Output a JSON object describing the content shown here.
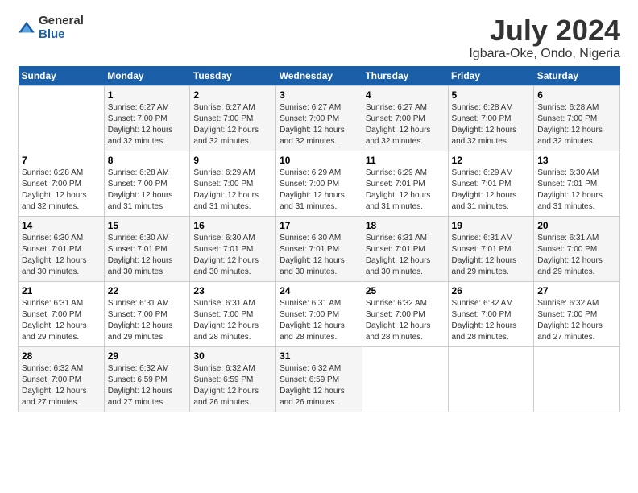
{
  "logo": {
    "general": "General",
    "blue": "Blue"
  },
  "title": "July 2024",
  "subtitle": "Igbara-Oke, Ondo, Nigeria",
  "days_of_week": [
    "Sunday",
    "Monday",
    "Tuesday",
    "Wednesday",
    "Thursday",
    "Friday",
    "Saturday"
  ],
  "weeks": [
    [
      {
        "num": "",
        "info": ""
      },
      {
        "num": "1",
        "info": "Sunrise: 6:27 AM\nSunset: 7:00 PM\nDaylight: 12 hours\nand 32 minutes."
      },
      {
        "num": "2",
        "info": "Sunrise: 6:27 AM\nSunset: 7:00 PM\nDaylight: 12 hours\nand 32 minutes."
      },
      {
        "num": "3",
        "info": "Sunrise: 6:27 AM\nSunset: 7:00 PM\nDaylight: 12 hours\nand 32 minutes."
      },
      {
        "num": "4",
        "info": "Sunrise: 6:27 AM\nSunset: 7:00 PM\nDaylight: 12 hours\nand 32 minutes."
      },
      {
        "num": "5",
        "info": "Sunrise: 6:28 AM\nSunset: 7:00 PM\nDaylight: 12 hours\nand 32 minutes."
      },
      {
        "num": "6",
        "info": "Sunrise: 6:28 AM\nSunset: 7:00 PM\nDaylight: 12 hours\nand 32 minutes."
      }
    ],
    [
      {
        "num": "7",
        "info": "Sunrise: 6:28 AM\nSunset: 7:00 PM\nDaylight: 12 hours\nand 32 minutes."
      },
      {
        "num": "8",
        "info": "Sunrise: 6:28 AM\nSunset: 7:00 PM\nDaylight: 12 hours\nand 31 minutes."
      },
      {
        "num": "9",
        "info": "Sunrise: 6:29 AM\nSunset: 7:00 PM\nDaylight: 12 hours\nand 31 minutes."
      },
      {
        "num": "10",
        "info": "Sunrise: 6:29 AM\nSunset: 7:00 PM\nDaylight: 12 hours\nand 31 minutes."
      },
      {
        "num": "11",
        "info": "Sunrise: 6:29 AM\nSunset: 7:01 PM\nDaylight: 12 hours\nand 31 minutes."
      },
      {
        "num": "12",
        "info": "Sunrise: 6:29 AM\nSunset: 7:01 PM\nDaylight: 12 hours\nand 31 minutes."
      },
      {
        "num": "13",
        "info": "Sunrise: 6:30 AM\nSunset: 7:01 PM\nDaylight: 12 hours\nand 31 minutes."
      }
    ],
    [
      {
        "num": "14",
        "info": "Sunrise: 6:30 AM\nSunset: 7:01 PM\nDaylight: 12 hours\nand 30 minutes."
      },
      {
        "num": "15",
        "info": "Sunrise: 6:30 AM\nSunset: 7:01 PM\nDaylight: 12 hours\nand 30 minutes."
      },
      {
        "num": "16",
        "info": "Sunrise: 6:30 AM\nSunset: 7:01 PM\nDaylight: 12 hours\nand 30 minutes."
      },
      {
        "num": "17",
        "info": "Sunrise: 6:30 AM\nSunset: 7:01 PM\nDaylight: 12 hours\nand 30 minutes."
      },
      {
        "num": "18",
        "info": "Sunrise: 6:31 AM\nSunset: 7:01 PM\nDaylight: 12 hours\nand 30 minutes."
      },
      {
        "num": "19",
        "info": "Sunrise: 6:31 AM\nSunset: 7:01 PM\nDaylight: 12 hours\nand 29 minutes."
      },
      {
        "num": "20",
        "info": "Sunrise: 6:31 AM\nSunset: 7:00 PM\nDaylight: 12 hours\nand 29 minutes."
      }
    ],
    [
      {
        "num": "21",
        "info": "Sunrise: 6:31 AM\nSunset: 7:00 PM\nDaylight: 12 hours\nand 29 minutes."
      },
      {
        "num": "22",
        "info": "Sunrise: 6:31 AM\nSunset: 7:00 PM\nDaylight: 12 hours\nand 29 minutes."
      },
      {
        "num": "23",
        "info": "Sunrise: 6:31 AM\nSunset: 7:00 PM\nDaylight: 12 hours\nand 28 minutes."
      },
      {
        "num": "24",
        "info": "Sunrise: 6:31 AM\nSunset: 7:00 PM\nDaylight: 12 hours\nand 28 minutes."
      },
      {
        "num": "25",
        "info": "Sunrise: 6:32 AM\nSunset: 7:00 PM\nDaylight: 12 hours\nand 28 minutes."
      },
      {
        "num": "26",
        "info": "Sunrise: 6:32 AM\nSunset: 7:00 PM\nDaylight: 12 hours\nand 28 minutes."
      },
      {
        "num": "27",
        "info": "Sunrise: 6:32 AM\nSunset: 7:00 PM\nDaylight: 12 hours\nand 27 minutes."
      }
    ],
    [
      {
        "num": "28",
        "info": "Sunrise: 6:32 AM\nSunset: 7:00 PM\nDaylight: 12 hours\nand 27 minutes."
      },
      {
        "num": "29",
        "info": "Sunrise: 6:32 AM\nSunset: 6:59 PM\nDaylight: 12 hours\nand 27 minutes."
      },
      {
        "num": "30",
        "info": "Sunrise: 6:32 AM\nSunset: 6:59 PM\nDaylight: 12 hours\nand 26 minutes."
      },
      {
        "num": "31",
        "info": "Sunrise: 6:32 AM\nSunset: 6:59 PM\nDaylight: 12 hours\nand 26 minutes."
      },
      {
        "num": "",
        "info": ""
      },
      {
        "num": "",
        "info": ""
      },
      {
        "num": "",
        "info": ""
      }
    ]
  ]
}
